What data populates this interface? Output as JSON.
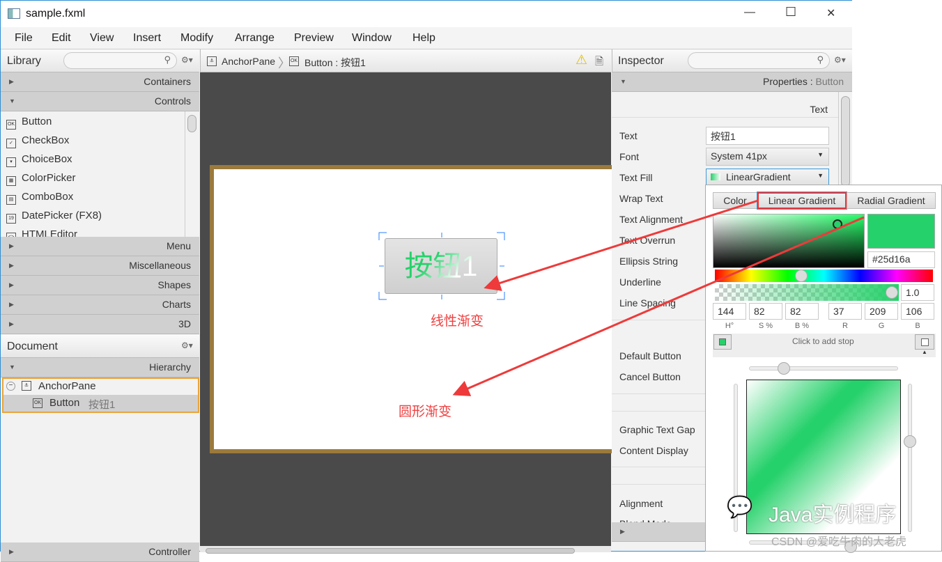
{
  "window": {
    "title": "sample.fxml",
    "minimize": "—",
    "maximize": "☐",
    "close": "✕"
  },
  "menu": [
    "File",
    "Edit",
    "View",
    "Insert",
    "Modify",
    "Arrange",
    "Preview",
    "Window",
    "Help"
  ],
  "library": {
    "title": "Library",
    "sections_top": [
      "Containers",
      "Controls"
    ],
    "controls": [
      {
        "icon": "OK",
        "label": "Button"
      },
      {
        "icon": "✓",
        "label": "CheckBox"
      },
      {
        "icon": "▾",
        "label": "ChoiceBox"
      },
      {
        "icon": "▦",
        "label": "ColorPicker"
      },
      {
        "icon": "▤",
        "label": "ComboBox"
      },
      {
        "icon": "19",
        "label": "DatePicker  (FX8)"
      },
      {
        "icon": "<>",
        "label": "HTMLEditor"
      }
    ],
    "sections_bottom": [
      "Menu",
      "Miscellaneous",
      "Shapes",
      "Charts",
      "3D"
    ]
  },
  "document": {
    "title": "Document",
    "section": "Hierarchy",
    "tree": [
      {
        "label": "AnchorPane"
      },
      {
        "label": "Button",
        "sub": "按钮1"
      }
    ],
    "controller": "Controller"
  },
  "breadcrumb": {
    "items": [
      "AnchorPane",
      "Button : 按钮1"
    ]
  },
  "canvas": {
    "button_text": "按钮1",
    "annotation_linear": "线性渐变",
    "annotation_radial": "圆形渐变"
  },
  "inspector": {
    "title": "Inspector",
    "section": "Properties",
    "section_target": "Button",
    "subsection": "Text",
    "props": [
      "Text",
      "Font",
      "Text Fill",
      "Wrap Text",
      "Text Alignment",
      "Text Overrun",
      "Ellipsis String",
      "Underline",
      "Line Spacing"
    ],
    "text_value": "按钮1",
    "font_value": "System 41px",
    "fill_value": "LinearGradient",
    "props2": [
      "Default Button",
      "Cancel Button"
    ],
    "props3": [
      "Graphic Text Gap",
      "Content Display"
    ],
    "props4": [
      "Alignment",
      "Blend Mode"
    ]
  },
  "picker": {
    "tabs": [
      "Color",
      "Linear Gradient",
      "Radial Gradient"
    ],
    "active_tab": "Linear Gradient",
    "hex": "#25d16a",
    "opacity": "1.0",
    "values": [
      "144",
      "82",
      "82",
      "37",
      "209",
      "106"
    ],
    "labels": [
      "H°",
      "S %",
      "B %",
      "R",
      "G",
      "B"
    ],
    "add_stop": "Click to add stop",
    "color": "#25d16a"
  },
  "watermark": {
    "brand": "Java实例程序",
    "credit": "CSDN @爱吃牛肉的大老虎"
  }
}
